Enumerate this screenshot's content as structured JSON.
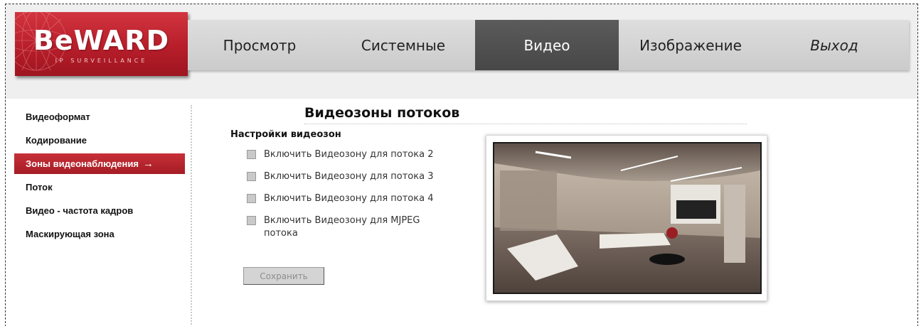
{
  "logo": {
    "brand": "BeWARD",
    "tagline": "IP SURVEILLANCE"
  },
  "nav": {
    "tabs": [
      {
        "label": "Просмотр"
      },
      {
        "label": "Системные"
      },
      {
        "label": "Видео"
      },
      {
        "label": "Изображение"
      },
      {
        "label": "Выход"
      }
    ],
    "active": "Видео"
  },
  "sidebar": {
    "items": [
      {
        "label": "Видеоформат"
      },
      {
        "label": "Кодирование"
      },
      {
        "label": "Зоны видеонаблюдения",
        "arrow": "→"
      },
      {
        "label": "Поток"
      },
      {
        "label": "Видео - частота кадров"
      },
      {
        "label": "Маскирующая зона"
      }
    ],
    "active": "Зоны видеонаблюдения"
  },
  "main": {
    "title": "Видеозоны потоков",
    "section": "Настройки видеозон",
    "options": [
      {
        "label": "Включить Видеозону для потока 2",
        "checked": false
      },
      {
        "label": "Включить Видеозону для потока 3",
        "checked": false
      },
      {
        "label": "Включить Видеозону для потока 4",
        "checked": false
      },
      {
        "label": "Включить Видеозону для MJPEG потока",
        "checked": false
      }
    ],
    "save_label": "Сохранить"
  },
  "colors": {
    "brand_red": "#b71e2a",
    "active_tab": "#4f4f4f",
    "nav_bg": "#d4d4d4"
  }
}
